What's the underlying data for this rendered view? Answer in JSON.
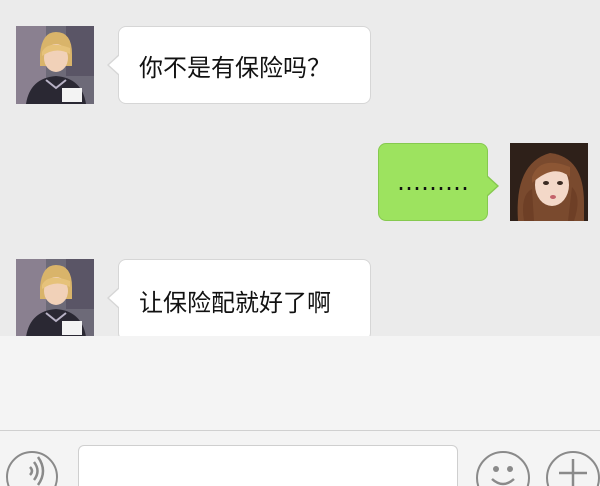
{
  "chat": {
    "messages": [
      {
        "sender": "contact",
        "text": "你不是有保险吗？"
      },
      {
        "sender": "me",
        "text": "………"
      },
      {
        "sender": "contact",
        "text": "让保险配就好了啊"
      }
    ]
  },
  "input_bar": {
    "text_value": "",
    "icons": {
      "voice": "voice-icon",
      "emoji": "emoji-icon",
      "more": "plus-icon"
    }
  },
  "colors": {
    "chat_background": "#ebebeb",
    "outgoing_bubble": "#9de35f",
    "incoming_bubble": "#ffffff"
  }
}
